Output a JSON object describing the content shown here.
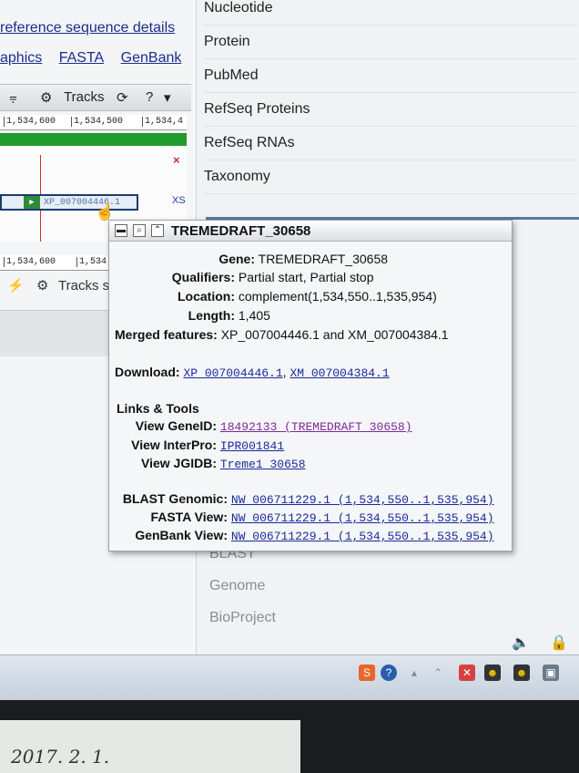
{
  "left": {
    "refseq_link": "reference sequence details",
    "views": [
      "aphics",
      "FASTA",
      "GenBank"
    ],
    "toolbar_tracks": "Tracks",
    "toolbar_help": "?",
    "ruler_top": [
      "1,534,600",
      "1,534,500",
      "1,534,4"
    ],
    "ruler_bottom": [
      "1,534,600",
      "1,534"
    ],
    "feature_label": "XP_007004446.1",
    "close_glyph": "×",
    "xs_label": "XS",
    "tracks2": "Tracks s"
  },
  "sidebar": {
    "items": [
      "Nucleotide",
      "Protein",
      "PubMed",
      "RefSeq Proteins",
      "RefSeq RNAs",
      "Taxonomy"
    ],
    "lower_items": [
      "BLAST",
      "Genome",
      "BioProject"
    ]
  },
  "popup": {
    "title": "TREMEDRAFT_30658",
    "gene_label": "Gene:",
    "gene": "TREMEDRAFT_30658",
    "qualifiers_label": "Qualifiers:",
    "qualifiers": "Partial start, Partial stop",
    "location_label": "Location:",
    "location": "complement(1,534,550..1,535,954)",
    "length_label": "Length:",
    "length": "1,405",
    "merged_label": "Merged features:",
    "merged": "XP_007004446.1 and XM_007004384.1",
    "download_label": "Download:",
    "download_1": "XP_007004446.1",
    "download_sep": ",",
    "download_2": "XM_007004384.1",
    "links_head": "Links & Tools",
    "geneid_label": "View GeneID:",
    "geneid": "18492133 (TREMEDRAFT_30658)",
    "interpro_label": "View InterPro:",
    "interpro": "IPR001841",
    "jgidb_label": "View JGIDB:",
    "jgidb": "Treme1_30658",
    "blast_label": "BLAST Genomic:",
    "blast": "NW_006711229.1 (1,534,550..1,535,954)",
    "fasta_label": "FASTA View:",
    "fasta": "NW_006711229.1 (1,534,550..1,535,954)",
    "genbank_label": "GenBank View:",
    "genbank": "NW_006711229.1 (1,534,550..1,535,954)"
  },
  "paper": {
    "handwriting": "2017. 2. 1."
  },
  "colors": {
    "link": "#1a2a9c",
    "visited": "#7b2a94",
    "green_track": "#1f9a2c",
    "sidebar_sep": "#5a75a0"
  }
}
